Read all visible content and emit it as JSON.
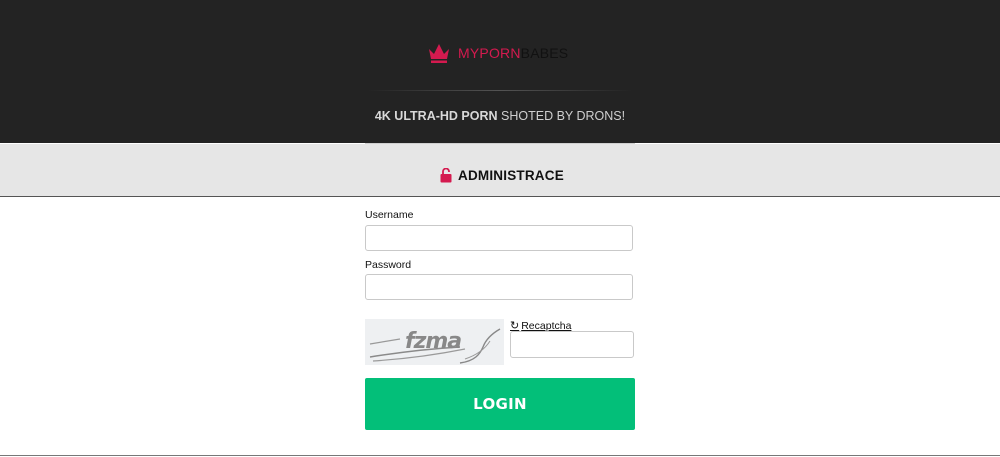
{
  "header": {
    "logo_part1": "MYPORN",
    "logo_part2": "BABES",
    "tagline_bold": "4K ULTRA-HD PORN",
    "tagline_rest": " SHOTED BY DRONS!"
  },
  "admin": {
    "title": "ADMINISTRACE"
  },
  "form": {
    "username_label": "Username",
    "username_value": "",
    "password_label": "Password",
    "password_value": "",
    "captcha_text": "fzma",
    "recaptcha_label": "Recaptcha",
    "captcha_value": "",
    "login_label": "LOGIN"
  },
  "colors": {
    "brand": "#d41a4f",
    "login_button": "#03bf79",
    "header_bg": "#232323",
    "admin_bar_bg": "#e6e6e6"
  }
}
